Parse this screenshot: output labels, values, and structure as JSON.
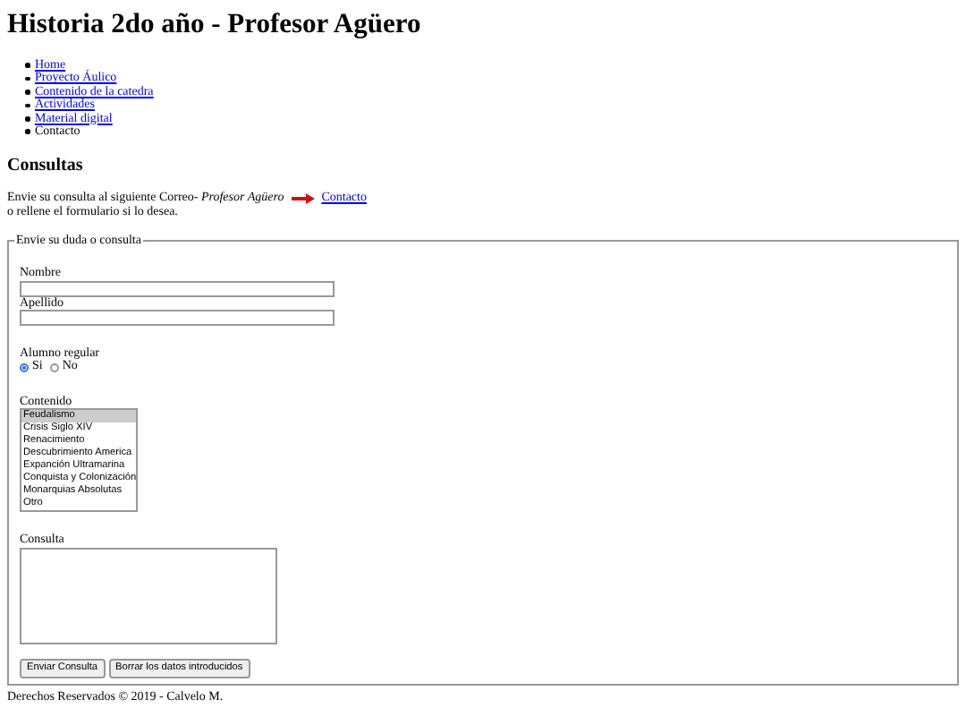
{
  "title": "Historia 2do año - Profesor Agüero",
  "nav": [
    {
      "label": "Home",
      "kind": "link"
    },
    {
      "label": "Proyecto Áulico",
      "kind": "link"
    },
    {
      "label": "Contenido de la catedra",
      "kind": "link"
    },
    {
      "label": "Actividades",
      "kind": "link"
    },
    {
      "label": "Material digital",
      "kind": "link"
    },
    {
      "label": "Contacto",
      "kind": "text"
    }
  ],
  "section_title": "Consultas",
  "intro": {
    "text": "Envie su consulta al siguiente Correo- *Profesor Agüero*",
    "link": "Contacto",
    "line2": "o rellene el formulario si lo desea."
  },
  "form": {
    "legend": "Envie su duda o consulta",
    "fields": [
      {
        "label": "Nombre",
        "kind": "text"
      },
      {
        "label": "Apellido",
        "kind": "text"
      }
    ],
    "radio_group": {
      "label": "Alumno regular",
      "options": [
        {
          "label": "Si",
          "selected": true
        },
        {
          "label": "No",
          "selected": false
        }
      ]
    },
    "listbox": {
      "label": "Contenido",
      "options": [
        {
          "label": "Feudalismo",
          "selected": true
        },
        {
          "label": "Crisis Siglo XIV",
          "selected": false
        },
        {
          "label": "Renacimiento",
          "selected": false
        },
        {
          "label": "Descubrimiento America",
          "selected": false
        },
        {
          "label": "Expanción Ultramarina",
          "selected": false
        },
        {
          "label": "Conquista y Colonización",
          "selected": false
        },
        {
          "label": "Monarquias Absolutas",
          "selected": false
        },
        {
          "label": "Otro",
          "selected": false
        }
      ]
    },
    "textarea": {
      "label": "Consulta"
    },
    "buttons": [
      "Enviar Consulta",
      "Borrar los datos introducidos"
    ]
  },
  "footer": "Derechos Reservados © 2019 - Calvelo M."
}
